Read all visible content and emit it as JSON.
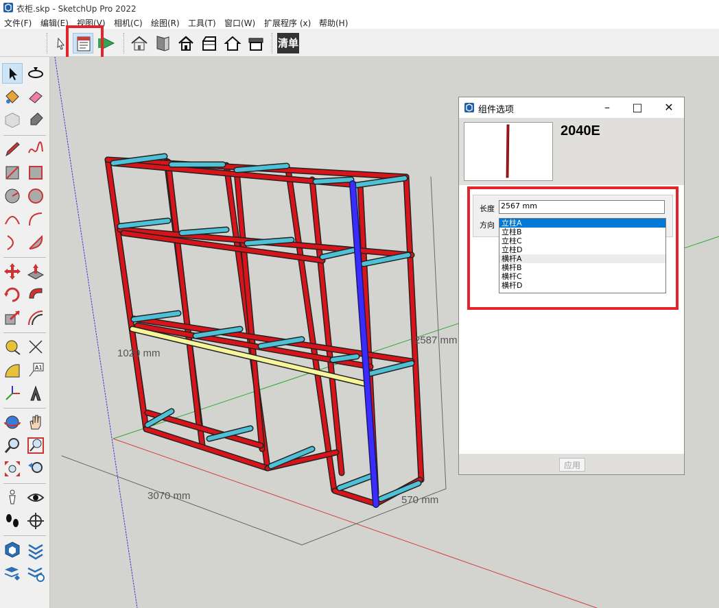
{
  "window": {
    "title": "衣柜.skp - SketchUp Pro 2022"
  },
  "menu": [
    "文件(F)",
    "编辑(E)",
    "视图(V)",
    "相机(C)",
    "绘图(R)",
    "工具(T)",
    "窗口(W)",
    "扩展程序 (x)",
    "帮助(H)"
  ],
  "toolbar": {
    "list_button": "清单",
    "icons": [
      "select-arrow-icon",
      "component-options-icon",
      "next-arrow-icon",
      "house-icon",
      "door-icon",
      "home-icon",
      "box-open-icon",
      "house-outline-icon",
      "box-icon"
    ]
  },
  "left_tools": [
    "select-icon",
    "orbit-icon",
    "paint-bucket-icon",
    "eraser-icon",
    "component-icon",
    "tag-icon",
    "pencil-icon",
    "freehand-icon",
    "rectangle-icon",
    "rotated-rectangle-icon",
    "circle-icon",
    "polygon-icon",
    "arc-icon",
    "arc-2-icon",
    "pie-icon",
    "arc-3-icon",
    "move-icon",
    "push-pull-icon",
    "rotate-icon",
    "follow-me-icon",
    "scale-icon",
    "offset-icon",
    "tape-measure-icon",
    "dimension-icon",
    "protractor-icon",
    "text-icon",
    "axes-icon",
    "3d-text-icon",
    "orbit-2-icon",
    "pan-icon",
    "zoom-icon",
    "zoom-window-icon",
    "zoom-extents-icon",
    "previous-view-icon",
    "position-camera-icon",
    "look-around-icon",
    "walk-icon",
    "section-plane-icon",
    "warehouse-icon",
    "extension-icon",
    "share-model-icon",
    "extension-manager-icon"
  ],
  "viewport": {
    "dimensions": {
      "width": "3070 mm",
      "depth": "570 mm",
      "height": "2587 mm",
      "shelf": "1020 mm"
    }
  },
  "dialog": {
    "title": "组件选项",
    "component_name": "2040E",
    "length_label": "长度",
    "length_value": "2567 mm",
    "direction_label": "方向",
    "direction_options": [
      "立柱A",
      "立柱B",
      "立柱C",
      "立柱D",
      "横杆A",
      "横杆B",
      "横杆C",
      "横杆D"
    ],
    "selected_option": "立柱A",
    "apply_button": "应用"
  },
  "colors": {
    "frame_red": "#d7141a",
    "rail_cyan": "#4fc1d6",
    "selected_blue": "#3a2bff",
    "highlight_yellow": "#f7f59a",
    "annotation_red": "#e3242b"
  }
}
